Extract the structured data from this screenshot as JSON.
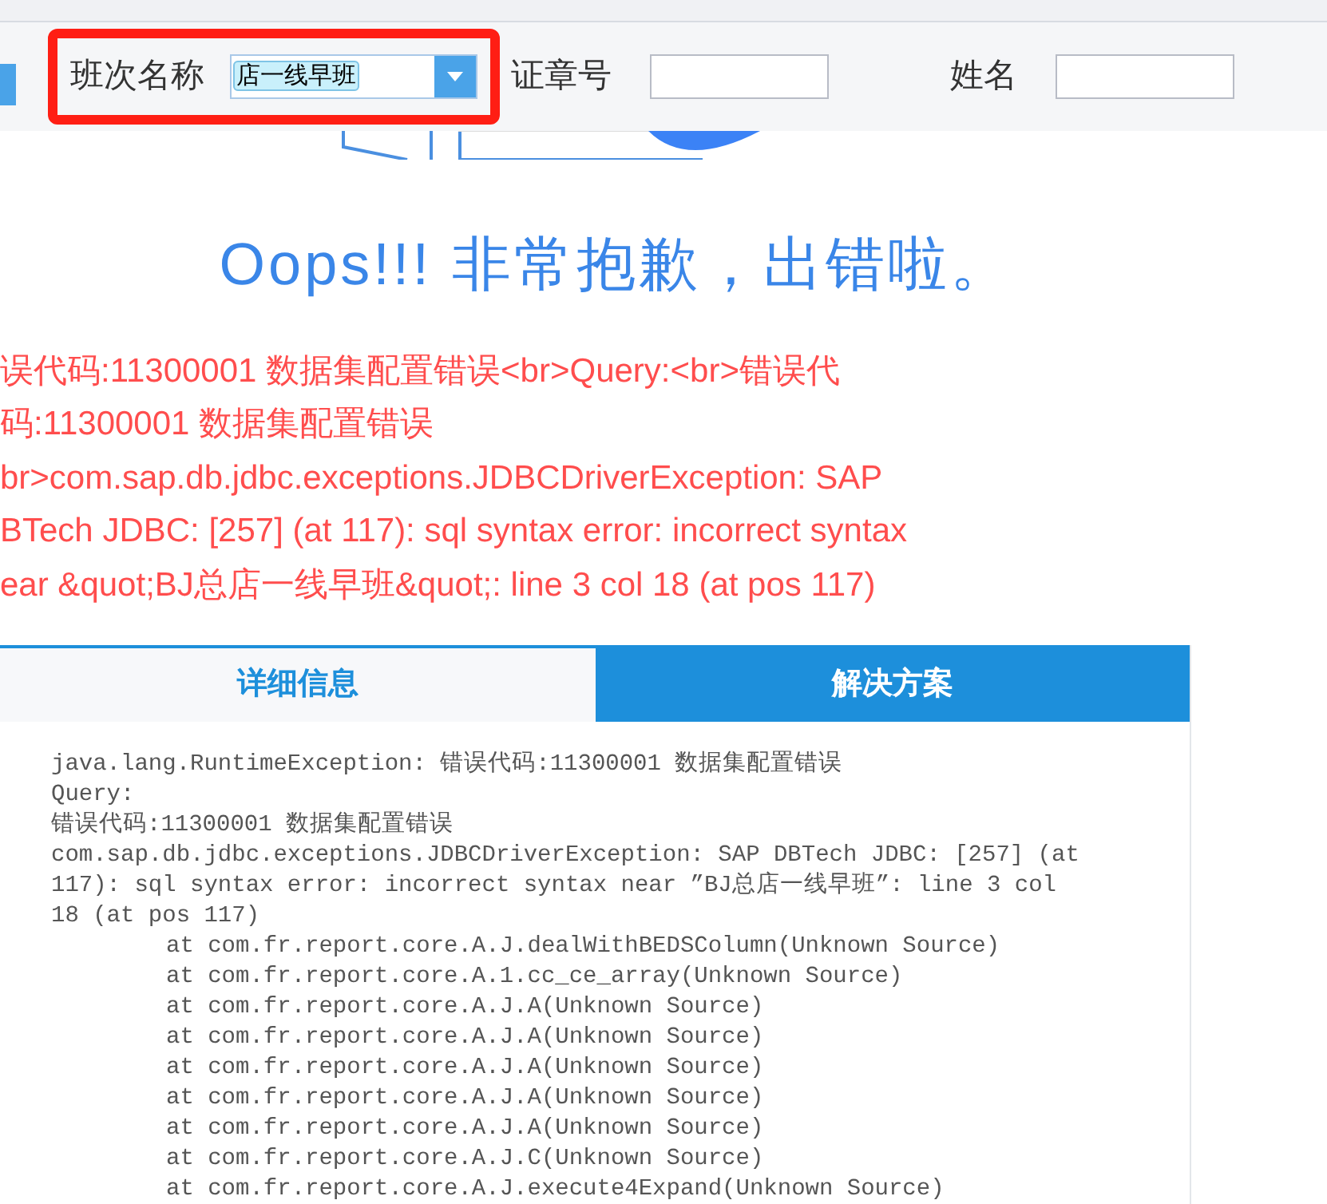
{
  "toolbar": {
    "fields": [
      {
        "kind": "select",
        "label": "班次名称",
        "value": "店一线早班",
        "highlighted": true
      },
      {
        "kind": "input",
        "label": "证章号",
        "highlighted": false
      },
      {
        "kind": "input",
        "label": "姓名",
        "highlighted": false
      }
    ]
  },
  "error": {
    "title": "Oops!!! 非常抱歉，出错啦。",
    "message_lines": [
      "误代码:11300001 数据集配置错误<br>Query:<br>错误代",
      "码:11300001 数据集配置错误",
      "br>com.sap.db.jdbc.exceptions.JDBCDriverException: SAP",
      "BTech JDBC: [257] (at 117): sql syntax error: incorrect syntax",
      "ear &quot;BJ总店一线早班&quot;: line 3 col 18 (at pos 117)"
    ]
  },
  "tabs": [
    {
      "label": "详细信息",
      "selected": true
    },
    {
      "label": "解决方案",
      "selected": false
    }
  ],
  "details": [
    {
      "kind": "text",
      "text": "java.lang.RuntimeException: 错误代码:11300001 数据集配置错误"
    },
    {
      "kind": "text",
      "text": "Query:"
    },
    {
      "kind": "text",
      "text": "错误代码:11300001 数据集配置错误"
    },
    {
      "kind": "text",
      "text": "com.sap.db.jdbc.exceptions.JDBCDriverException: SAP DBTech JDBC: [257] (at"
    },
    {
      "kind": "text",
      "text": "117): sql syntax error: incorrect syntax near ”BJ总店一线早班”: line 3 col"
    },
    {
      "kind": "text",
      "text": "18 (at pos 117)"
    },
    {
      "kind": "frame",
      "text": "at com.fr.report.core.A.J.dealWithBEDSColumn(Unknown Source)"
    },
    {
      "kind": "frame",
      "text": "at com.fr.report.core.A.1.cc_ce_array(Unknown Source)"
    },
    {
      "kind": "frame",
      "text": "at com.fr.report.core.A.J.A(Unknown Source)"
    },
    {
      "kind": "frame",
      "text": "at com.fr.report.core.A.J.A(Unknown Source)"
    },
    {
      "kind": "frame",
      "text": "at com.fr.report.core.A.J.A(Unknown Source)"
    },
    {
      "kind": "frame",
      "text": "at com.fr.report.core.A.J.A(Unknown Source)"
    },
    {
      "kind": "frame",
      "text": "at com.fr.report.core.A.J.A(Unknown Source)"
    },
    {
      "kind": "frame",
      "text": "at com.fr.report.core.A.J.C(Unknown Source)"
    },
    {
      "kind": "frame",
      "text": "at com.fr.report.core.A.J.execute4Expand(Unknown Source)"
    }
  ]
}
